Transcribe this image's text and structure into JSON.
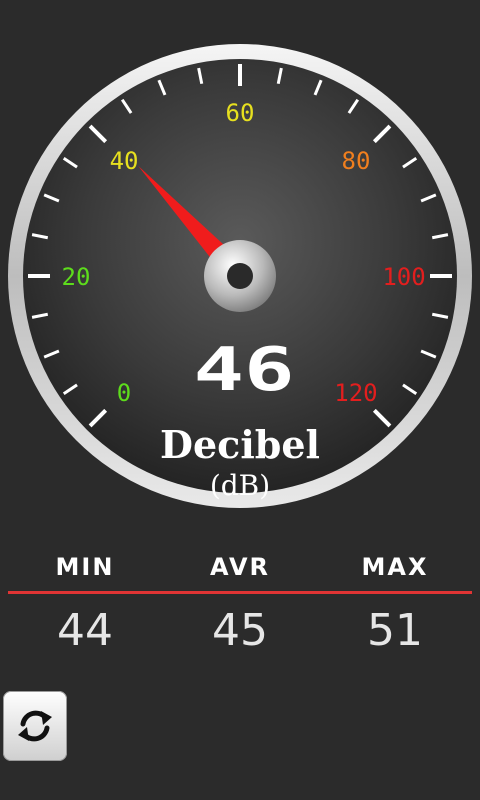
{
  "gauge": {
    "reading": 46,
    "reading_label": "46",
    "min_scale": 0,
    "max_scale": 120,
    "needle_value": 41,
    "unit_name": "Decibel",
    "unit_symbol": "(dB)",
    "scale_labels": [
      {
        "text": "0",
        "value": 0,
        "color": "#5ddc1c"
      },
      {
        "text": "20",
        "value": 20,
        "color": "#5ddc1c"
      },
      {
        "text": "40",
        "value": 40,
        "color": "#e7e01f"
      },
      {
        "text": "60",
        "value": 60,
        "color": "#e7e01f"
      },
      {
        "text": "80",
        "value": 80,
        "color": "#f07f1e"
      },
      {
        "text": "100",
        "value": 100,
        "color": "#e31e1e"
      },
      {
        "text": "120",
        "value": 120,
        "color": "#e31e1e"
      }
    ],
    "needle_color": "#f01c1c"
  },
  "stats": {
    "min_label": "MIN",
    "avr_label": "AVR",
    "max_label": "MAX",
    "min_value": "44",
    "avr_value": "45",
    "max_value": "51"
  },
  "colors": {
    "background": "#2b2b2b",
    "divider": "#e03434"
  },
  "controls": {
    "refresh_icon": "refresh-icon"
  }
}
